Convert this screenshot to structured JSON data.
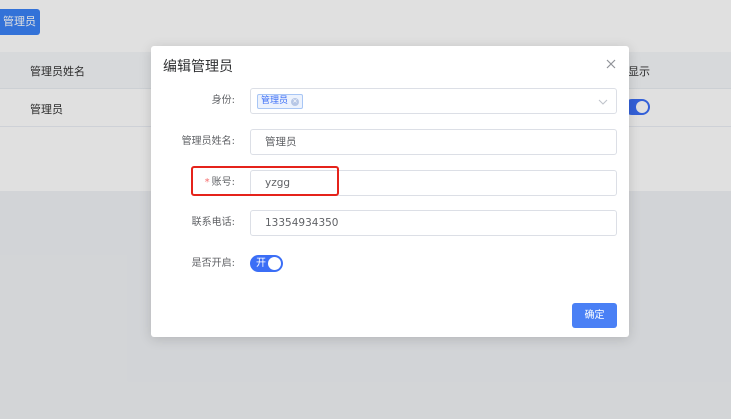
{
  "background": {
    "add_button_label": "管理员",
    "table": {
      "headers": [
        "管理员姓名",
        "显示"
      ],
      "rows": [
        {
          "name": "管理员"
        }
      ]
    }
  },
  "dialog": {
    "title": "编辑管理员",
    "fields": {
      "role": {
        "label": "身份:",
        "tag": "管理员"
      },
      "name": {
        "label": "管理员姓名:",
        "value": "管理员"
      },
      "account": {
        "label": "账号:",
        "value": "yzgg",
        "required_mark": "*"
      },
      "phone": {
        "label": "联系电话:",
        "value": "13354934350"
      },
      "enabled": {
        "label": "是否开启:",
        "toggle_text": "开"
      }
    },
    "confirm_label": "确定"
  },
  "colors": {
    "primary": "#3b6ef6",
    "highlight": "#e5231b"
  }
}
